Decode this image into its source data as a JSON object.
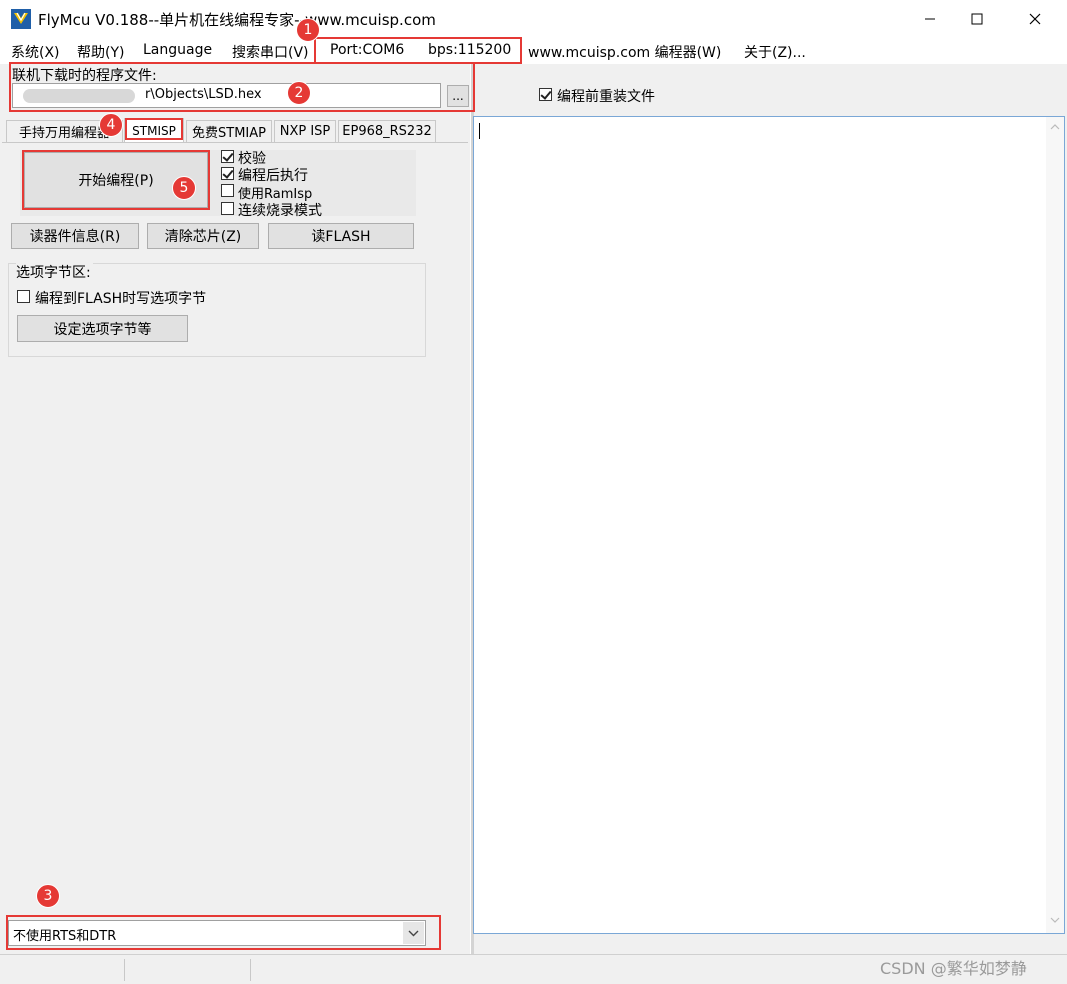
{
  "window": {
    "title": "FlyMcu V0.188--单片机在线编程专家--www.mcuisp.com"
  },
  "menu": {
    "items": [
      "系统(X)",
      "帮助(Y)",
      "Language",
      "搜索串口(V)",
      "Port:COM6",
      "bps:115200",
      "www.mcuisp.com 编程器(W)",
      "关于(Z)..."
    ]
  },
  "file": {
    "label": "联机下载时的程序文件:",
    "path": "r\\Objects\\LSD.hex",
    "browse_label": "..."
  },
  "reload": {
    "label": "编程前重装文件",
    "checked": true
  },
  "tabs": [
    "手持万用编程器",
    "STMISP",
    "免费STMIAP",
    "NXP ISP",
    "EP968_RS232"
  ],
  "stmisp": {
    "start_button": "开始编程(P)",
    "options": [
      {
        "label": "校验",
        "checked": true
      },
      {
        "label": "编程后执行",
        "checked": true
      },
      {
        "label": "使用RamIsp",
        "checked": false
      },
      {
        "label": "连续烧录模式",
        "checked": false
      }
    ],
    "read_info_button": "读器件信息(R)",
    "erase_button": "清除芯片(Z)",
    "read_flash_button": "读FLASH"
  },
  "option_bytes": {
    "group_label": "选项字节区:",
    "write_checkbox_label": "编程到FLASH时写选项字节",
    "write_checked": false,
    "settings_button": "设定选项字节等"
  },
  "dtr_select": {
    "value": "不使用RTS和DTR"
  },
  "annotations": [
    "1",
    "2",
    "3",
    "4",
    "5"
  ],
  "watermark": "CSDN @繁华如梦静",
  "colors": {
    "highlight": "#e53935",
    "titlebar": "#ffffff",
    "client": "#f0f0f0"
  }
}
